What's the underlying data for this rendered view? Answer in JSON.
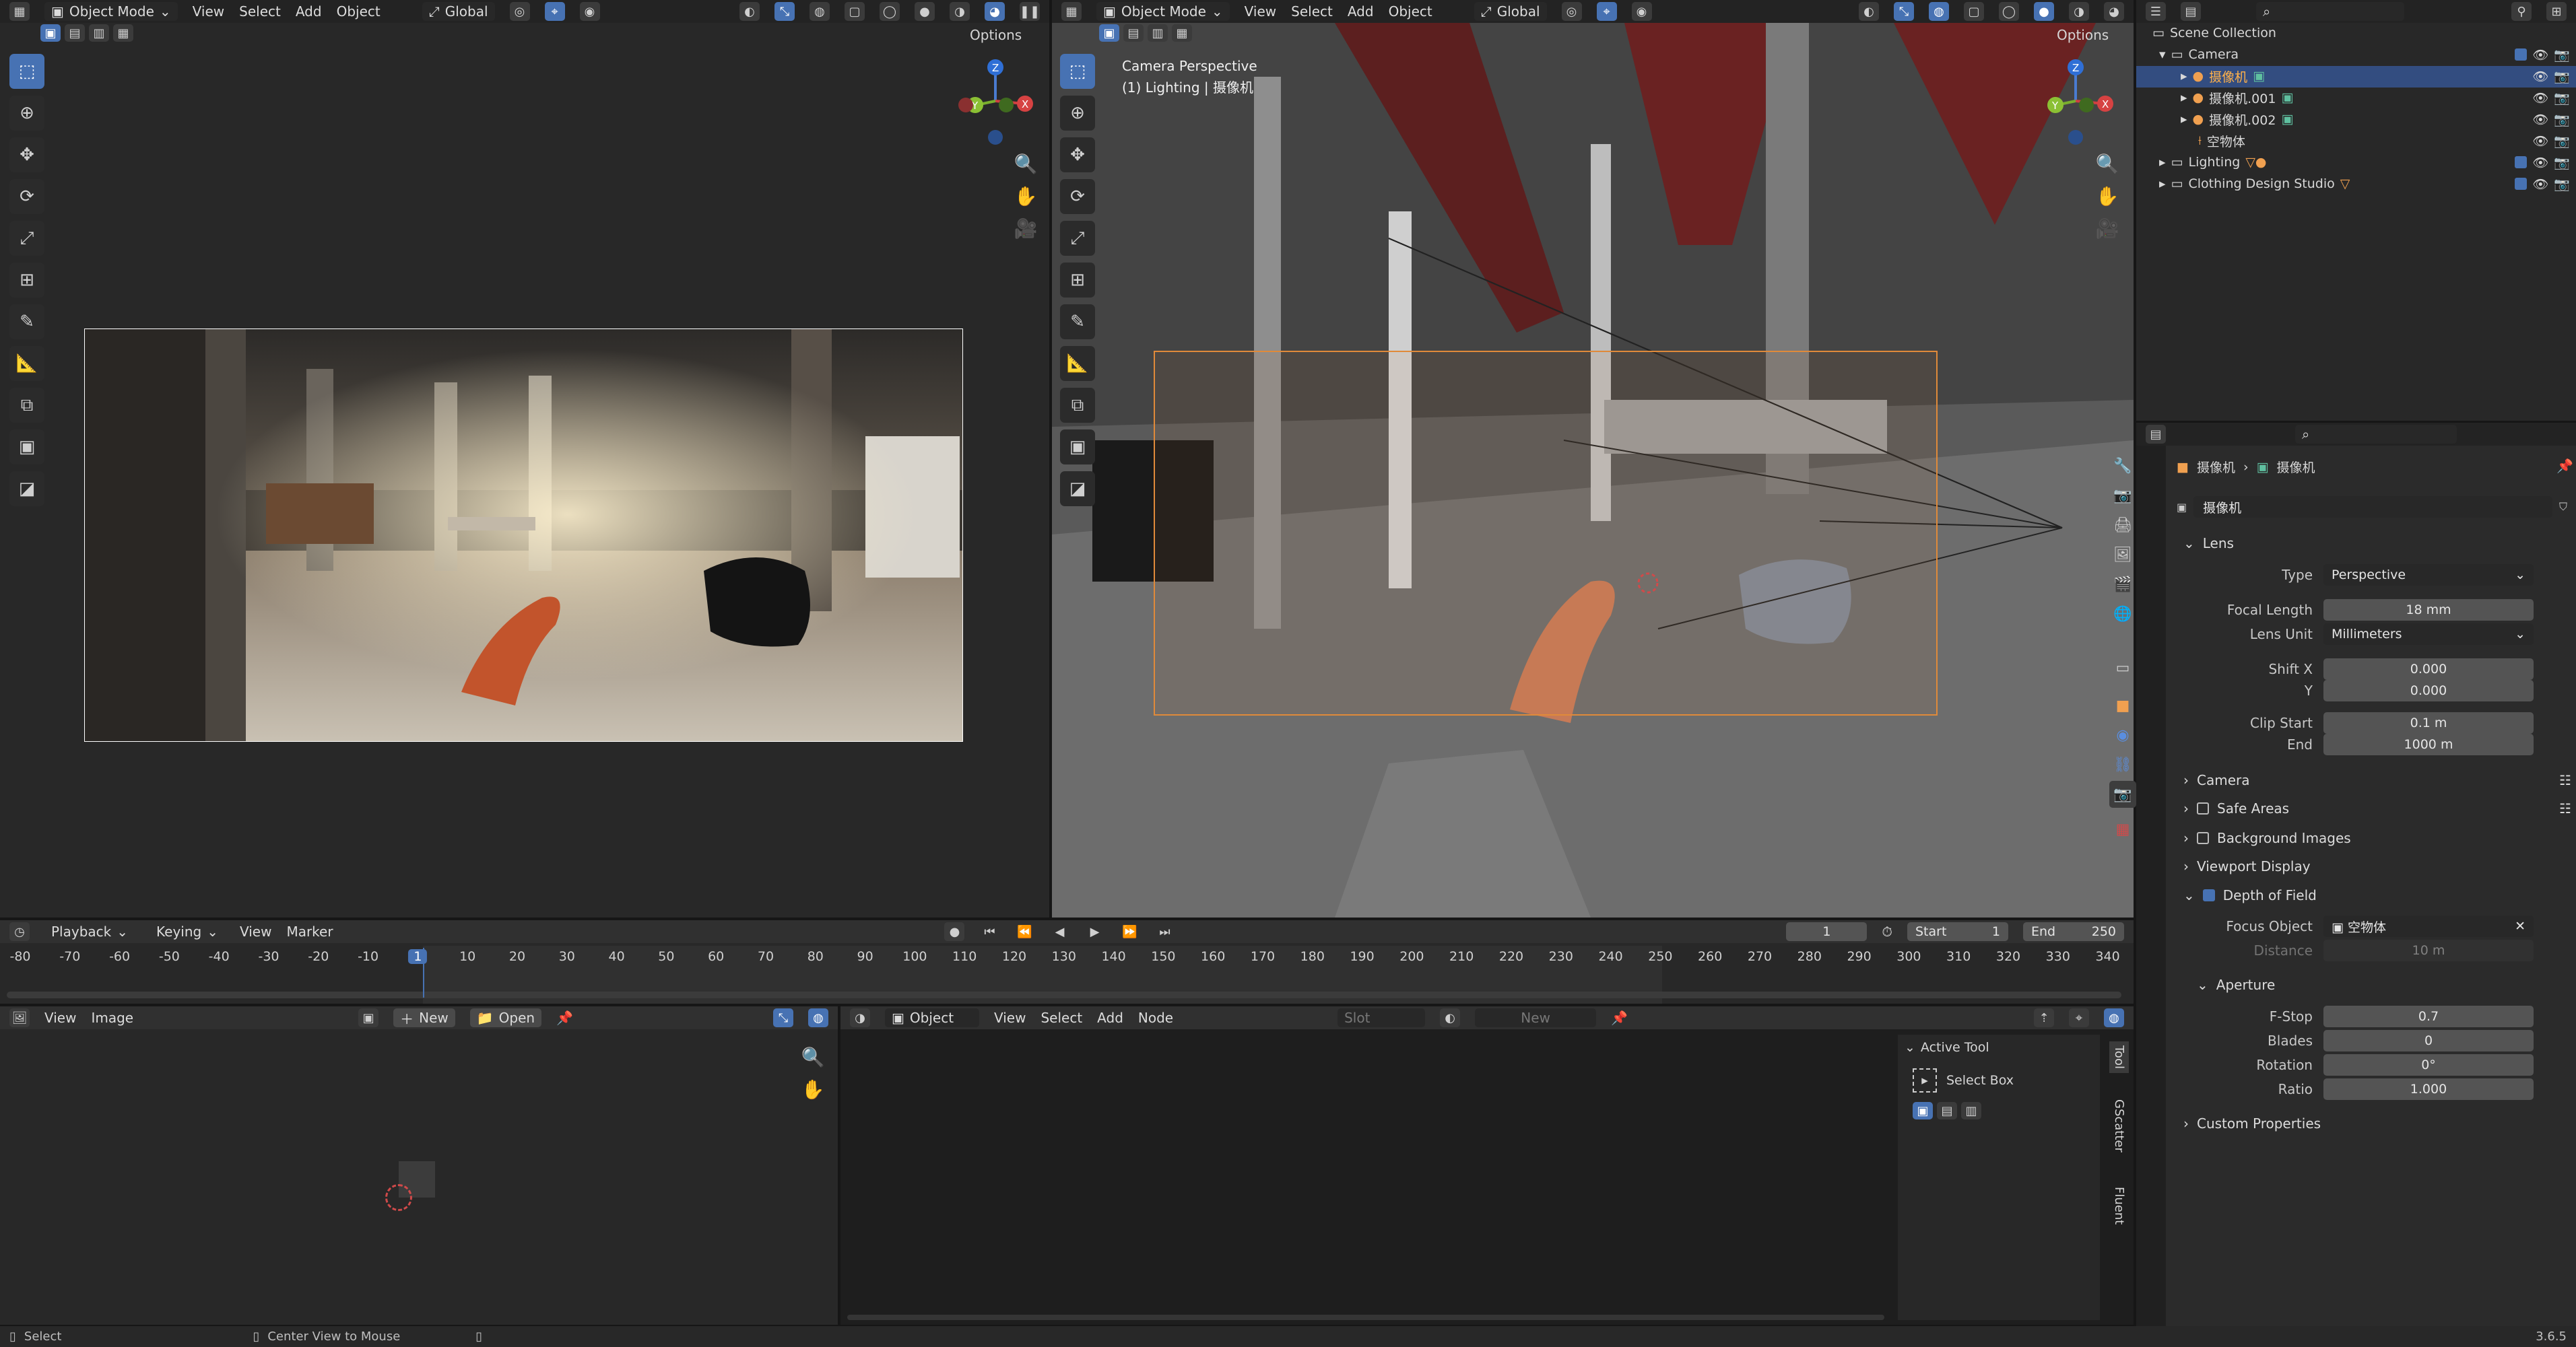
{
  "top_left_header": {
    "mode": "Object Mode",
    "menus": [
      "View",
      "Select",
      "Add",
      "Object"
    ],
    "orientation": "Global",
    "options": "Options"
  },
  "top_right_header": {
    "mode": "Object Mode",
    "menus": [
      "View",
      "Select",
      "Add",
      "Object"
    ],
    "orientation": "Global",
    "options": "Options"
  },
  "right_viewport": {
    "view_name": "Camera Perspective",
    "view_sub": "(1) Lighting | 摄像机"
  },
  "outliner": {
    "items": [
      {
        "label": "Scene Collection"
      },
      {
        "label": "Camera"
      },
      {
        "label": "摄像机"
      },
      {
        "label": "摄像机.001"
      },
      {
        "label": "摄像机.002"
      },
      {
        "label": "空物体"
      },
      {
        "label": "Lighting"
      },
      {
        "label": "Clothing Design Studio"
      }
    ]
  },
  "properties": {
    "breadcrumb_object": "摄像机",
    "breadcrumb_data": "摄像机",
    "data_name": "摄像机",
    "lens_section": "Lens",
    "type_label": "Type",
    "type_value": "Perspective",
    "focal_label": "Focal Length",
    "focal_value": "18 mm",
    "lens_unit_label": "Lens Unit",
    "lens_unit_value": "Millimeters",
    "shiftx_label": "Shift X",
    "shiftx_value": "0.000",
    "shifty_label": "Y",
    "shifty_value": "0.000",
    "clip_start_label": "Clip Start",
    "clip_start_value": "0.1 m",
    "clip_end_label": "End",
    "clip_end_value": "1000 m",
    "camera_section": "Camera",
    "safe_areas_section": "Safe Areas",
    "bg_images_section": "Background Images",
    "viewport_display_section": "Viewport Display",
    "dof_section": "Depth of Field",
    "focus_object_label": "Focus Object",
    "focus_object_value": "空物体",
    "distance_label": "Distance",
    "distance_value": "10 m",
    "aperture_section": "Aperture",
    "fstop_label": "F-Stop",
    "fstop_value": "0.7",
    "blades_label": "Blades",
    "blades_value": "0",
    "rotation_label": "Rotation",
    "rotation_value": "0°",
    "ratio_label": "Ratio",
    "ratio_value": "1.000",
    "custom_props_section": "Custom Properties"
  },
  "timeline": {
    "menus": [
      "Playback",
      "Keying",
      "View",
      "Marker"
    ],
    "current_frame": "1",
    "start_label": "Start",
    "start_value": "1",
    "end_label": "End",
    "end_value": "250",
    "ticks": [
      "-80",
      "-70",
      "-60",
      "-50",
      "-40",
      "-30",
      "-20",
      "-10",
      "1",
      "10",
      "20",
      "30",
      "40",
      "50",
      "60",
      "70",
      "80",
      "90",
      "100",
      "110",
      "120",
      "130",
      "140",
      "150",
      "160",
      "170",
      "180",
      "190",
      "200",
      "210",
      "220",
      "230",
      "240",
      "250",
      "260",
      "270",
      "280",
      "290",
      "300",
      "310",
      "320",
      "330",
      "340"
    ]
  },
  "image_editor": {
    "menus": [
      "View",
      "Image"
    ],
    "new_label": "New",
    "open_label": "Open"
  },
  "node_editor": {
    "object_label": "Object",
    "menus": [
      "View",
      "Select",
      "Add",
      "Node"
    ],
    "slot_label": "Slot",
    "new_label": "New"
  },
  "n_panel": {
    "active_tool": "Active Tool",
    "select_box": "Select Box",
    "tabs": [
      "Tool",
      "GScatter",
      "Fluent"
    ]
  },
  "status_bar": {
    "select": "Select",
    "center_view": "Center View to Mouse",
    "version": "3.6.5"
  }
}
